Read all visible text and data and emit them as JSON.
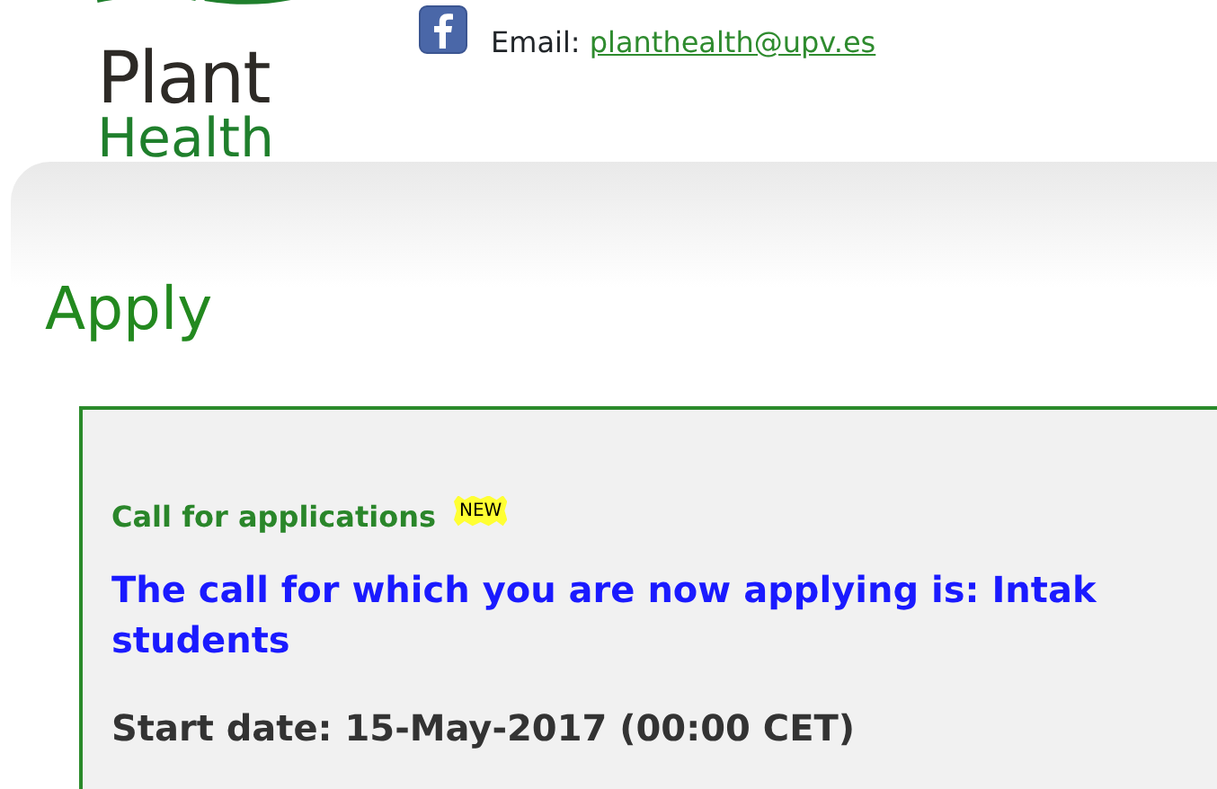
{
  "logo": {
    "line_1": "Plant",
    "line_2": "Health"
  },
  "contact": {
    "label": "Email:",
    "email": "planthealth@upv.es"
  },
  "page_title": "Apply",
  "call": {
    "heading": "Call for applications",
    "badge": "NEW",
    "description_lines": [
      "The call for which you are now applying is: Intak",
      "students"
    ],
    "start_date": "Start date: 15-May-2017 (00:00 CET)"
  }
}
